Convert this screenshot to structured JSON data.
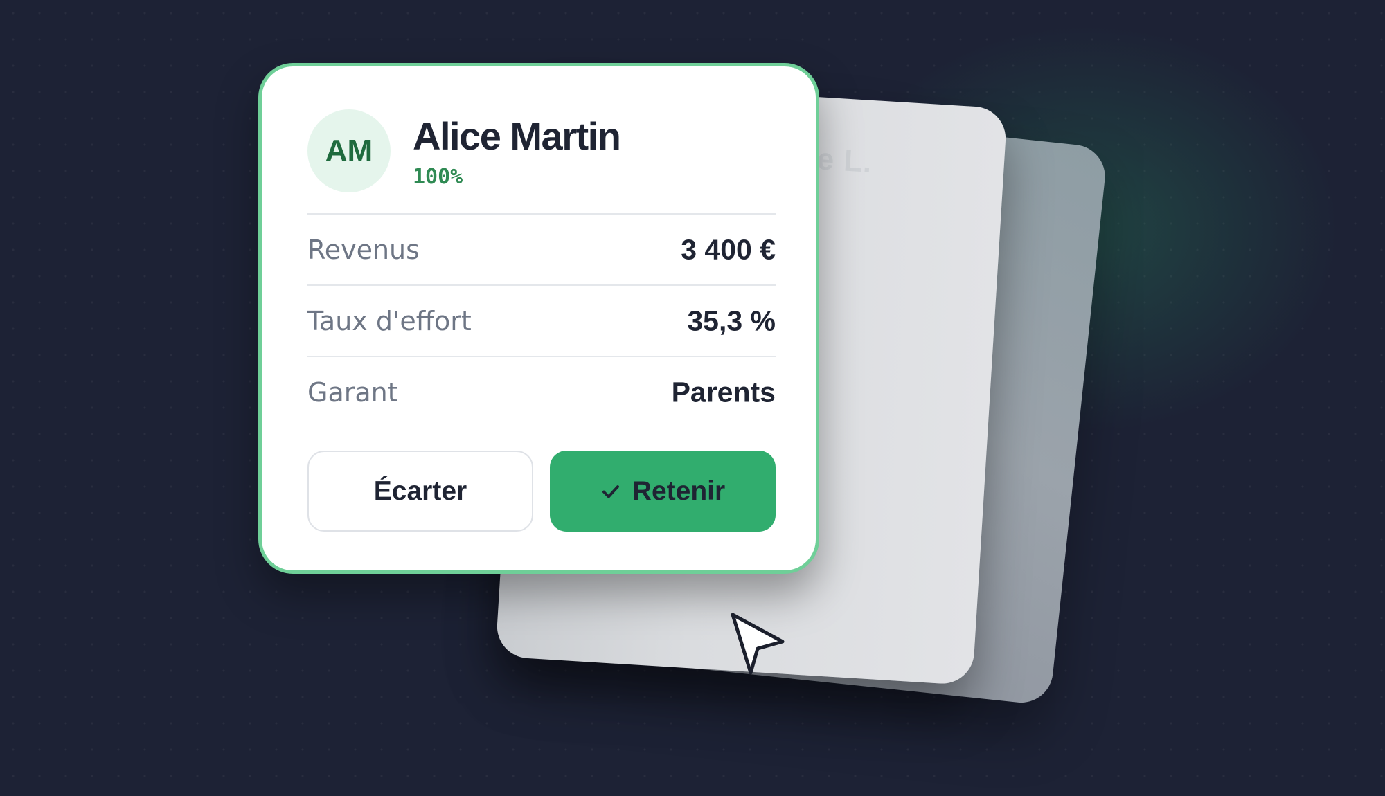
{
  "background_cards": {
    "mid_card_ghost_text": "e L."
  },
  "applicant": {
    "initials": "AM",
    "name": "Alice Martin",
    "score": "100%"
  },
  "details": [
    {
      "label": "Revenus",
      "value": "3 400 €"
    },
    {
      "label": "Taux d'effort",
      "value": "35,3 %"
    },
    {
      "label": "Garant",
      "value": "Parents"
    }
  ],
  "actions": {
    "reject_label": "Écarter",
    "accept_label": "Retenir"
  },
  "colors": {
    "accent": "#31ad6e",
    "card_border": "#6fcf98",
    "score_text": "#2f8a53",
    "background": "#1d2235"
  },
  "icons": {
    "accept": "check-icon",
    "pointer": "mouse-pointer-icon"
  }
}
